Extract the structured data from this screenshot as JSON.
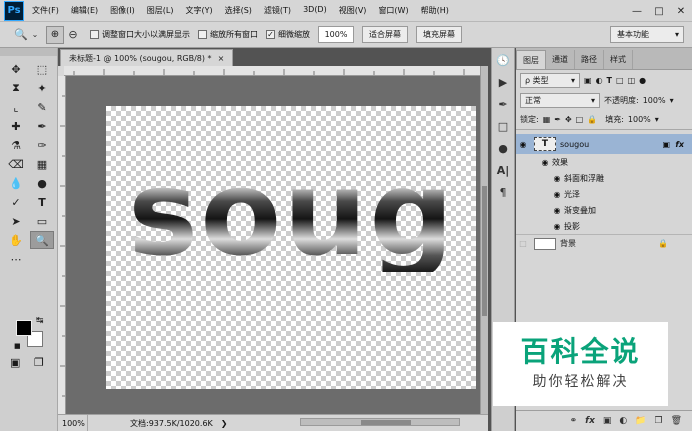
{
  "app": {
    "logo": "Ps"
  },
  "menu": [
    "文件(F)",
    "编辑(E)",
    "图像(I)",
    "图层(L)",
    "文字(Y)",
    "选择(S)",
    "滤镜(T)",
    "3D(D)",
    "视图(V)",
    "窗口(W)",
    "帮助(H)"
  ],
  "window_controls": {
    "minimize": "—",
    "restore": "□",
    "close": "✕"
  },
  "options": {
    "resize_windows": "调整窗口大小以满屏显示",
    "zoom_all_windows": "缩放所有窗口",
    "scrubby_zoom": "细微缩放",
    "zoom_value": "100%",
    "fit_screen": "适合屏幕",
    "fill_screen": "填充屏幕",
    "workspace": "基本功能",
    "checks": {
      "resize_windows": false,
      "zoom_all_windows": false,
      "scrubby_zoom": true
    }
  },
  "document": {
    "tab_title": "未标题-1 @ 100% (sougou, RGB/8) *",
    "tab_close": "×",
    "text": "soug"
  },
  "status": {
    "zoom": "100%",
    "info": "文档:937.5K/1020.6K"
  },
  "panel": {
    "tabs": [
      "图层",
      "通道",
      "路径",
      "样式"
    ],
    "filter_kind": "ρ 类型",
    "blend_mode": "正常",
    "opacity_label": "不透明度:",
    "opacity_value": "100%",
    "lock_label": "锁定:",
    "fill_label": "填充:",
    "fill_value": "100%",
    "layers": [
      {
        "name": "sougou",
        "fx": "fx"
      },
      {
        "name": "效果"
      },
      {
        "name": "斜面和浮雕"
      },
      {
        "name": "光泽"
      },
      {
        "name": "渐变叠加"
      },
      {
        "name": "投影"
      },
      {
        "name": "背景"
      }
    ]
  },
  "watermark": {
    "line1": "百科全说",
    "line2": "助你轻松解决"
  }
}
